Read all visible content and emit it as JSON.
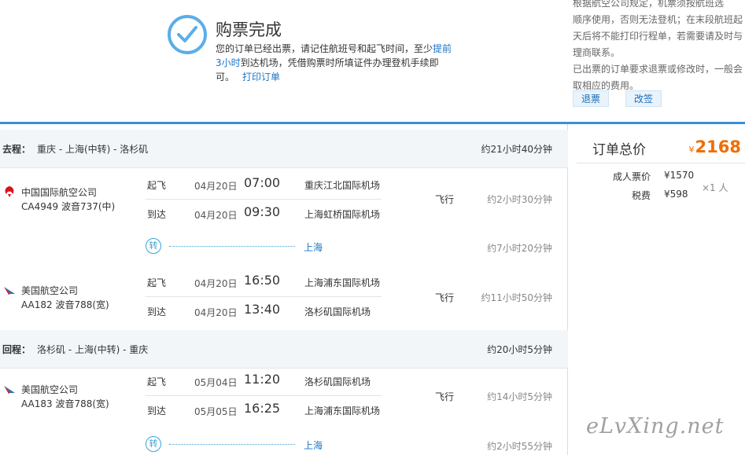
{
  "confirm": {
    "title": "购票完成",
    "line1_a": "您的订单已经出票，请记住航班号和起飞时间，至少",
    "line1_hl": "提前",
    "line2_hl": "3小时",
    "line2_a": "到达机场，凭借购票时所填证件办理登机手续即",
    "line3_a": "可。",
    "print_link": "打印订单"
  },
  "rules": {
    "lines": [
      "根据航空公司规定，机票须按航班选",
      "顺序使用，否则无法登机；在末段航班起",
      "天后将不能打印行程单，若需要请及时与",
      "理商联系。",
      "已出票的订单要求退票或修改时，一般会",
      "取相应的费用。"
    ],
    "refund_label": "退票",
    "change_label": "改签"
  },
  "legs": [
    {
      "label": "去程：",
      "route": "重庆 - 上海(中转) - 洛杉矶",
      "duration": "约21小时40分钟",
      "segments": [
        {
          "airline": "中国国际航空公司",
          "flight": "CA4949 波音737(中)",
          "dep_label": "起飞",
          "dep_date": "04月20日",
          "dep_time": "07:00",
          "dep_airport": "重庆江北国际机场",
          "arr_label": "到达",
          "arr_date": "04月20日",
          "arr_time": "09:30",
          "arr_airport": "上海虹桥国际机场",
          "fly": "飞行",
          "fly_duration": "约2小时30分钟"
        },
        {
          "airline": "美国航空公司",
          "flight": "AA182 波音788(宽)",
          "dep_label": "起飞",
          "dep_date": "04月20日",
          "dep_time": "16:50",
          "dep_airport": "上海浦东国际机场",
          "arr_label": "到达",
          "arr_date": "04月20日",
          "arr_time": "13:40",
          "arr_airport": "洛杉矶国际机场",
          "fly": "飞行",
          "fly_duration": "约11小时50分钟"
        }
      ],
      "transfer": {
        "icon": "转",
        "city": "上海",
        "duration": "约7小时20分钟"
      }
    },
    {
      "label": "回程：",
      "route": "洛杉矶 - 上海(中转) - 重庆",
      "duration": "约20小时5分钟",
      "segments": [
        {
          "airline": "美国航空公司",
          "flight": "AA183 波音788(宽)",
          "dep_label": "起飞",
          "dep_date": "05月04日",
          "dep_time": "11:20",
          "dep_airport": "洛杉矶国际机场",
          "arr_label": "到达",
          "arr_date": "05月05日",
          "arr_time": "16:25",
          "arr_airport": "上海浦东国际机场",
          "fly": "飞行",
          "fly_duration": "约14小时5分钟"
        }
      ],
      "transfer": {
        "icon": "转",
        "city": "上海",
        "duration": "约2小时55分钟"
      }
    }
  ],
  "price": {
    "title": "订单总价",
    "currency": "¥",
    "total": "2168",
    "adult_label": "成人票价",
    "adult_value": "¥1570",
    "tax_label": "税费",
    "tax_value": "¥598",
    "per_person": "×1 人"
  },
  "watermark": "eLvXing.net",
  "colors": {
    "accent": "#3c8fd6",
    "link": "#1a73c8",
    "price": "#f06d00",
    "air_china": "#d7141a",
    "american": "#2a6fb5"
  }
}
